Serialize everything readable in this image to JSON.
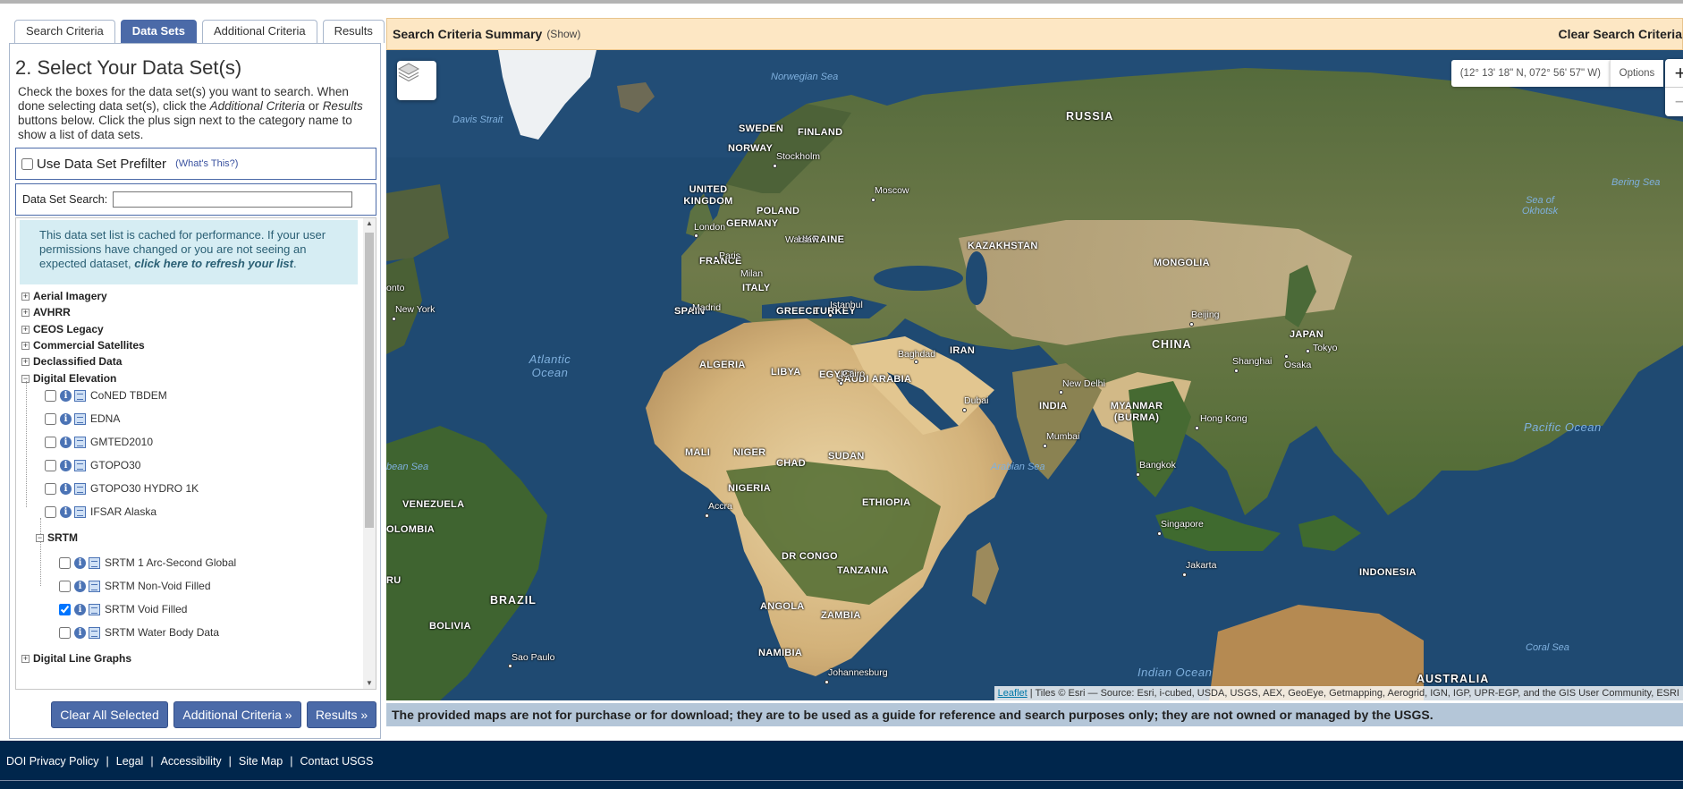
{
  "tabs": [
    "Search Criteria",
    "Data Sets",
    "Additional Criteria",
    "Results"
  ],
  "active_tab": "Data Sets",
  "panel": {
    "title": "2. Select Your Data Set(s)",
    "intro_1": "Check the boxes for the data set(s) you want to search. When done selecting data set(s), click the ",
    "intro_em1": "Additional Criteria",
    "intro_2": " or ",
    "intro_em2": "Results",
    "intro_3": " buttons below. Click the plus sign next to the category name to show a list of data sets.",
    "prefilter_label": "Use Data Set Prefilter",
    "whats_this": "(What's This?)",
    "search_label": "Data Set Search:",
    "search_value": "",
    "cache_note_text": "This data set list is cached for performance. If your user permissions have changed or you are not seeing an expected dataset, ",
    "cache_note_link": "click here to refresh your list",
    "cache_note_end": "."
  },
  "tree": {
    "categories_top": [
      "Aerial Imagery",
      "AVHRR",
      "CEOS Legacy",
      "Commercial Satellites",
      "Declassified Data"
    ],
    "expanded_category": "Digital Elevation",
    "elevation_datasets": [
      {
        "label": "CoNED TBDEM",
        "checked": false
      },
      {
        "label": "EDNA",
        "checked": false
      },
      {
        "label": "GMTED2010",
        "checked": false
      },
      {
        "label": "GTOPO30",
        "checked": false
      },
      {
        "label": "GTOPO30 HYDRO 1K",
        "checked": false
      },
      {
        "label": "IFSAR Alaska",
        "checked": false
      }
    ],
    "subcategory": "SRTM",
    "srtm_datasets": [
      {
        "label": "SRTM 1 Arc-Second Global",
        "checked": false
      },
      {
        "label": "SRTM Non-Void Filled",
        "checked": false
      },
      {
        "label": "SRTM Void Filled",
        "checked": true
      },
      {
        "label": "SRTM Water Body Data",
        "checked": false
      }
    ],
    "categories_bottom": [
      "Digital Line Graphs"
    ]
  },
  "buttons": {
    "clear": "Clear All Selected",
    "additional": "Additional Criteria »",
    "results": "Results »"
  },
  "summary": {
    "title": "Search Criteria Summary",
    "show": "(Show)",
    "clear": "Clear Search Criteria"
  },
  "map": {
    "coords": "(12° 13' 18\" N, 072° 56' 57\" W)",
    "options": "Options",
    "zoom_in": "+",
    "zoom_out": "−",
    "attribution_link": "Leaflet",
    "attribution_text": " | Tiles © Esri — Source: Esri, i-cubed, USDA, USGS, AEX, GeoEye, Getmapping, Aerogrid, IGN, IGP, UPR-EGP, and the GIS User Community, ESRI",
    "labels": {
      "russia": "RUSSIA",
      "sweden": "SWEDEN",
      "finland": "FINLAND",
      "norway": "NORWAY",
      "uk": "UNITED KINGDOM",
      "poland": "POLAND",
      "germany": "GERMANY",
      "ukraine": "UKRAINE",
      "france": "FRANCE",
      "italy": "ITALY",
      "spain": "SPAIN",
      "greece": "GREECE",
      "turkey": "TURKEY",
      "kazakhstan": "KAZAKHSTAN",
      "mongolia": "MONGOLIA",
      "china": "CHINA",
      "japan": "JAPAN",
      "iran": "IRAN",
      "india": "INDIA",
      "myanmar": "MYANMAR (BURMA)",
      "saudi": "SAUDI ARABIA",
      "egypt": "EGYPT",
      "libya": "LIBYA",
      "algeria": "ALGERIA",
      "mali": "MALI",
      "niger": "NIGER",
      "chad": "CHAD",
      "sudan": "SUDAN",
      "nigeria": "NIGERIA",
      "ethiopia": "ETHIOPIA",
      "drc": "DR CONGO",
      "tanzania": "TANZANIA",
      "angola": "ANGOLA",
      "zambia": "ZAMBIA",
      "namibia": "NAMIBIA",
      "brazil": "BRAZIL",
      "bolivia": "BOLIVIA",
      "venezuela": "VENEZUELA",
      "colombia": "OLOMBIA",
      "peru": "RU",
      "indonesia": "INDONESIA",
      "australia": "AUSTRALIA",
      "stockholm": "Stockholm",
      "moscow": "Moscow",
      "london": "London",
      "warsaw": "Warsaw",
      "paris": "Paris",
      "milan": "Milan",
      "madrid": "Madrid",
      "istanbul": "Istanbul",
      "baghdad": "Baghdad",
      "cairo": "Cairo",
      "dubai": "Dubai",
      "newdelhi": "New Delhi",
      "mumbai": "Mumbai",
      "beijing": "Beijing",
      "shanghai": "Shanghai",
      "tokyo": "Tokyo",
      "osaka": "Osaka",
      "hongkong": "Hong Kong",
      "bangkok": "Bangkok",
      "singapore": "Singapore",
      "jakarta": "Jakarta",
      "accra": "Accra",
      "johannesburg": "Johannesburg",
      "saopaulo": "Sao Paulo",
      "newyork": "New York",
      "toronto": "onto",
      "norwegian_sea": "Norwegian Sea",
      "davis_strait": "Davis Strait",
      "atlantic": "Atlantic Ocean",
      "arabian_sea": "Arabian Sea",
      "indian_ocean": "Indian Ocean",
      "pacific": "Pacific Ocean",
      "bering": "Bering Sea",
      "okhotsk": "Sea of Okhotsk",
      "coral": "Coral Sea",
      "caribbean": "bean Sea"
    },
    "colors": {
      "water": "#1f4a72",
      "land_forest": "#3e5a2a",
      "land_desert": "#d8bb86",
      "ice": "#f2f4f5"
    }
  },
  "disclaimer": "The provided maps are not for purchase or for download; they are to be used as a guide for reference and search purposes only; they are not owned or managed by the USGS.",
  "footer": {
    "links": [
      "DOI Privacy Policy",
      "Legal",
      "Accessibility",
      "Site Map",
      "Contact USGS"
    ],
    "separator": "|"
  }
}
